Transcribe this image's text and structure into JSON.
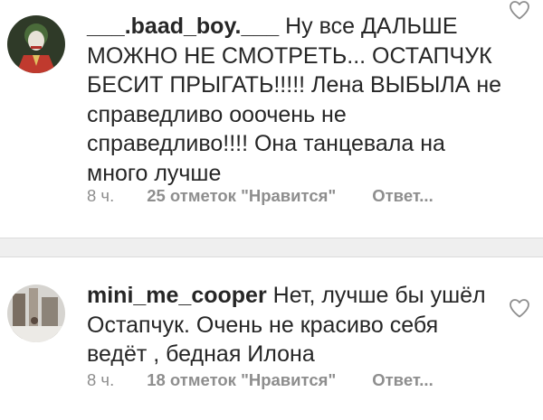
{
  "comments": [
    {
      "username": "___.baad_boy.___",
      "text": " Ну все ДАЛЬШЕ МОЖНО НЕ СМОТРЕТЬ... ОСТАПЧУК БЕСИТ ПРЫГАТЬ!!!!! Лена ВЫБЫЛА не справедливо ооочень не справедливо!!!! Она танцевала на много лучше",
      "time": "8 ч.",
      "likes": "25 отметок \"Нравится\"",
      "reply": "Ответ..."
    },
    {
      "username": "mini_me_cooper",
      "text": " Нет, лучше бы ушёл Остапчук. Очень не красиво себя ведёт , бедная Илона",
      "time": "8 ч.",
      "likes": "18 отметок \"Нравится\"",
      "reply": "Ответ..."
    }
  ],
  "colors": {
    "text": "#262626",
    "meta": "#8e8e8e",
    "divider": "#efefef"
  },
  "icons": {
    "like": "heart-outline-icon"
  }
}
